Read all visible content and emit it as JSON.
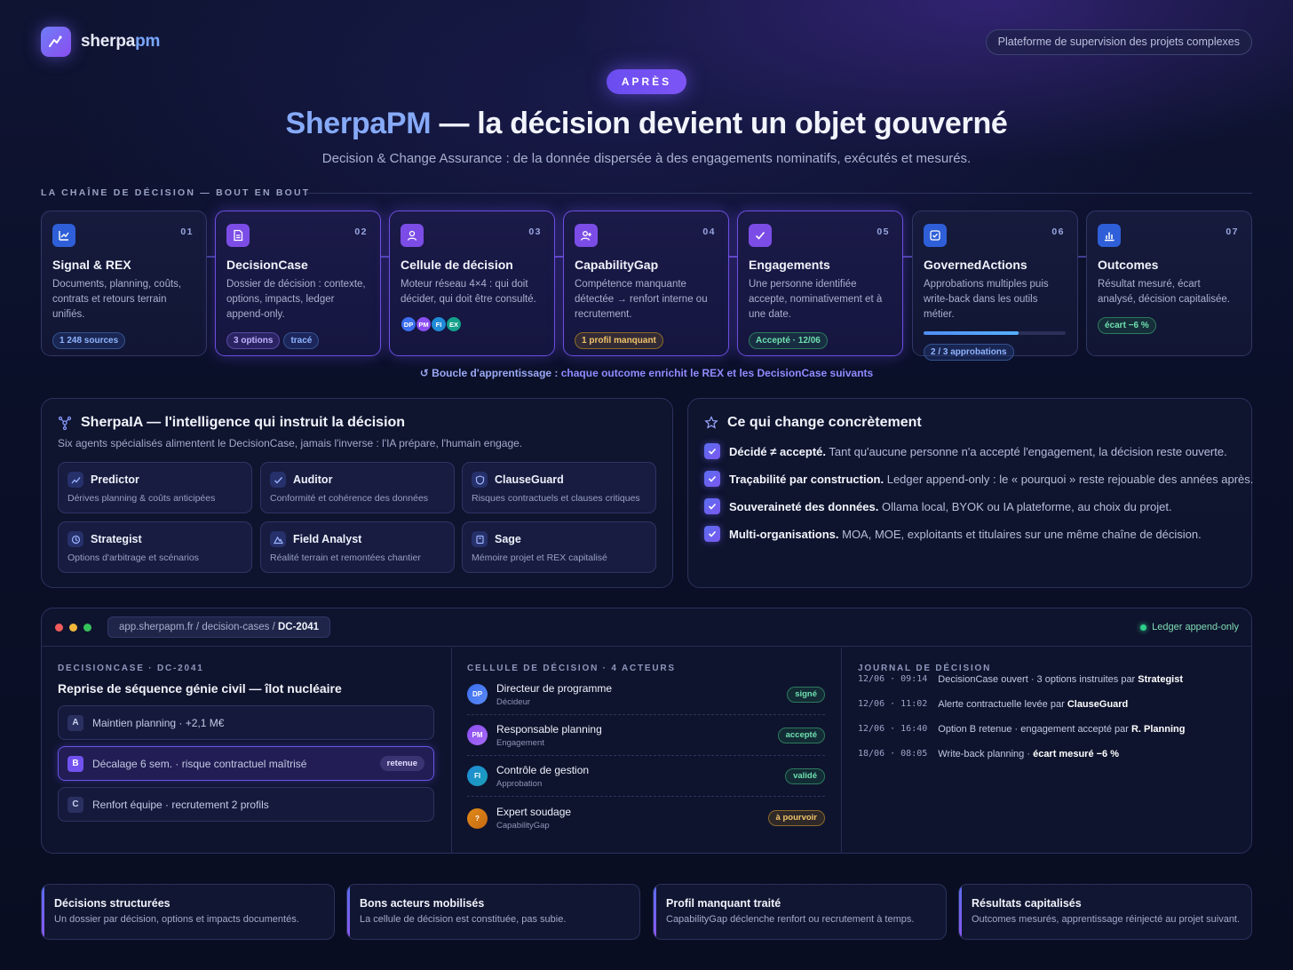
{
  "header": {
    "brand_main": "sherpa",
    "brand_accent": "pm",
    "tagline": "Plateforme de supervision des projets complexes",
    "badge": "APRÈS",
    "title_highlight": "SherpaPM",
    "title_rest": " — la décision devient un objet gouverné",
    "subtitle": "Decision & Change Assurance : de la donnée dispersée à des engagements nominatifs, exécutés et mesurés."
  },
  "chain": {
    "label": "LA CHAÎNE DE DÉCISION — BOUT EN BOUT",
    "steps": [
      {
        "num": "01",
        "name": "Signal & REX",
        "desc": "Documents, planning, coûts, contrats et retours terrain unifiés.",
        "pill": "1 248 sources",
        "icon": "chart-line-icon",
        "color": "#2f5fd8"
      },
      {
        "num": "02",
        "name": "DecisionCase",
        "desc": "Dossier de décision : contexte, options, impacts, ledger append-only.",
        "pill": "3 options",
        "pill2": "tracé",
        "icon": "document-icon",
        "color": "#7c4de6"
      },
      {
        "num": "03",
        "name": "Cellule de décision",
        "desc": "Moteur réseau 4×4 : qui doit décider, qui doit être consulté.",
        "avatars": [
          "DP",
          "PM",
          "FI",
          "EX"
        ],
        "icon": "user-icon",
        "color": "#7c4de6"
      },
      {
        "num": "04",
        "name": "CapabilityGap",
        "desc": "Compétence manquante détectée → renfort interne ou recrutement.",
        "pill": "1 profil manquant",
        "icon": "user-plus-icon",
        "color": "#7c4de6"
      },
      {
        "num": "05",
        "name": "Engagements",
        "desc": "Une personne identifiée accepte, nominativement et à une date.",
        "pill": "Accepté · 12/06",
        "icon": "check-icon",
        "color": "#7c4de6"
      },
      {
        "num": "06",
        "name": "GovernedActions",
        "desc": "Approbations multiples puis write-back dans les outils métier.",
        "pill": "2 / 3 approbations",
        "progress": 0.67,
        "icon": "check-square-icon",
        "color": "#2f5fd8"
      },
      {
        "num": "07",
        "name": "Outcomes",
        "desc": "Résultat mesuré, écart analysé, décision capitalisée.",
        "pill": "écart −6 %",
        "icon": "bar-chart-icon",
        "color": "#2f5fd8"
      }
    ],
    "loop_prefix": "↺ Boucle d'apprentissage : ",
    "loop_text": "chaque outcome enrichit le REX et les DecisionCase suivants"
  },
  "ia": {
    "title": "SherpaIA — l'intelligence qui instruit la décision",
    "subtitle": "Six agents spécialisés alimentent le DecisionCase, jamais l'inverse : l'IA prépare, l'humain engage.",
    "agents": [
      {
        "name": "Predictor",
        "desc": "Dérives planning & coûts anticipées",
        "icon": "trend-icon"
      },
      {
        "name": "Auditor",
        "desc": "Conformité et cohérence des données",
        "icon": "check-icon"
      },
      {
        "name": "ClauseGuard",
        "desc": "Risques contractuels et clauses critiques",
        "icon": "shield-icon"
      },
      {
        "name": "Strategist",
        "desc": "Options d'arbitrage et scénarios",
        "icon": "clock-icon"
      },
      {
        "name": "Field Analyst",
        "desc": "Réalité terrain et remontées chantier",
        "icon": "mountain-icon"
      },
      {
        "name": "Sage",
        "desc": "Mémoire projet et REX capitalisé",
        "icon": "book-icon"
      }
    ]
  },
  "changes": {
    "title": "Ce qui change concrètement",
    "items": [
      {
        "bold": "Décidé ≠ accepté.",
        "text": " Tant qu'aucune personne n'a accepté l'engagement, la décision reste ouverte."
      },
      {
        "bold": "Traçabilité par construction.",
        "text": " Ledger append-only : le « pourquoi » reste rejouable des années après."
      },
      {
        "bold": "Souveraineté des données.",
        "text": " Ollama local, BYOK ou IA plateforme, au choix du projet."
      },
      {
        "bold": "Multi-organisations.",
        "text": " MOA, MOE, exploitants et titulaires sur une même chaîne de décision."
      }
    ]
  },
  "window": {
    "url_path": "app.sherpapm.fr / decision-cases / ",
    "url_id": "DC-2041",
    "ledger": "Ledger append-only",
    "dc_label": "DECISIONCASE · DC-2041",
    "dc_title": "Reprise de séquence génie civil — îlot nucléaire",
    "options": [
      {
        "key": "A",
        "text": "Maintien planning · +2,1 M€"
      },
      {
        "key": "B",
        "text": "Décalage 6 sem. · risque contractuel maîtrisé",
        "tag": "retenue"
      },
      {
        "key": "C",
        "text": "Renfort équipe · recrutement 2 profils"
      }
    ],
    "cell_label": "CELLULE DE DÉCISION · 4 ACTEURS",
    "actors": [
      {
        "initials": "DP",
        "name": "Directeur de programme",
        "role": "Décideur",
        "status": "signé",
        "color": "#3a6ef0",
        "tone": "green"
      },
      {
        "initials": "PM",
        "name": "Responsable planning",
        "role": "Engagement",
        "status": "accepté",
        "color": "#8a4df0",
        "tone": "green"
      },
      {
        "initials": "FI",
        "name": "Contrôle de gestion",
        "role": "Approbation",
        "status": "validé",
        "color": "#1f8ad6",
        "tone": "green"
      },
      {
        "initials": "?",
        "name": "Expert soudage",
        "role": "CapabilityGap",
        "status": "à pourvoir",
        "color": "#e08a1a",
        "tone": "amber"
      }
    ],
    "journal_label": "JOURNAL DE DÉCISION",
    "journal": [
      {
        "time": "12/06 · 09:14",
        "text": "DecisionCase ouvert · 3 options instruites par ",
        "bold": "Strategist"
      },
      {
        "time": "12/06 · 11:02",
        "text": "Alerte contractuelle levée par ",
        "bold": "ClauseGuard"
      },
      {
        "time": "12/06 · 16:40",
        "text": "Option B retenue · engagement accepté par ",
        "bold": "R. Planning"
      },
      {
        "time": "18/06 · 08:05",
        "text": "Write-back planning · ",
        "bold": "écart mesuré −6 %"
      }
    ]
  },
  "outcomes": [
    {
      "title": "Décisions structurées",
      "desc": "Un dossier par décision, options et impacts documentés."
    },
    {
      "title": "Bons acteurs mobilisés",
      "desc": "La cellule de décision est constituée, pas subie."
    },
    {
      "title": "Profil manquant traité",
      "desc": "CapabilityGap déclenche renfort ou recrutement à temps."
    },
    {
      "title": "Résultats capitalisés",
      "desc": "Outcomes mesurés, apprentissage réinjecté au projet suivant."
    }
  ]
}
